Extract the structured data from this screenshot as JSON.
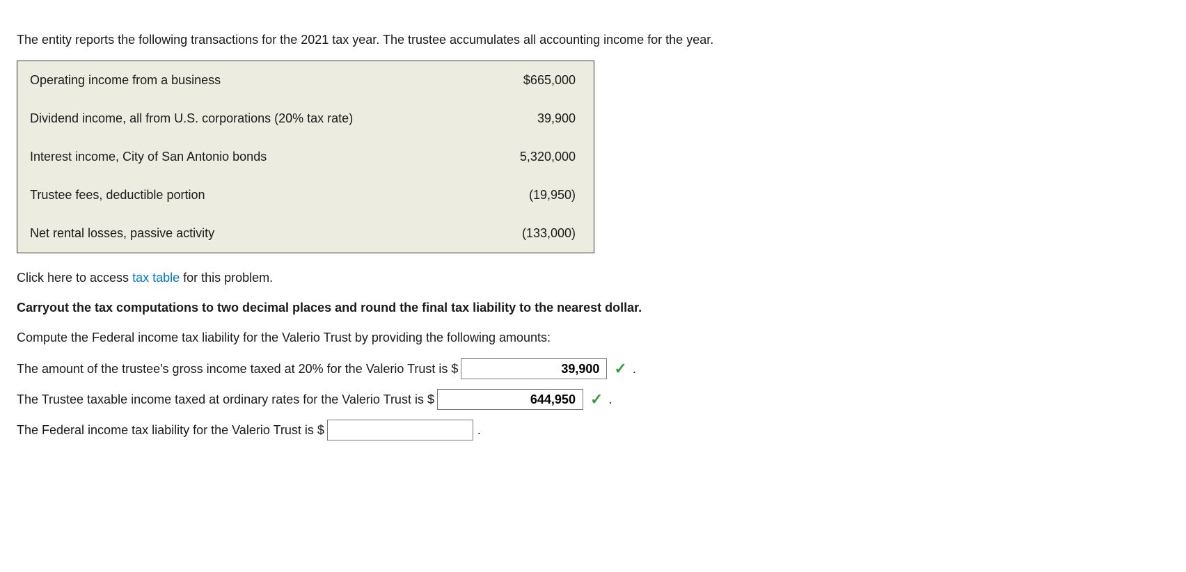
{
  "intro": "The entity reports the following transactions for the 2021 tax year. The trustee accumulates all accounting income for the year.",
  "table": {
    "rows": [
      {
        "label": "Operating income from a business",
        "amount": "$665,000"
      },
      {
        "label": "Dividend income, all from U.S. corporations (20% tax rate)",
        "amount": "39,900"
      },
      {
        "label": "Interest income, City of San Antonio bonds",
        "amount": "5,320,000"
      },
      {
        "label": "Trustee fees, deductible portion",
        "amount": "(19,950)"
      },
      {
        "label": "Net rental losses, passive activity",
        "amount": "(133,000)"
      }
    ]
  },
  "link_pre": "Click here to access ",
  "link_text": "tax table",
  "link_post": " for this problem.",
  "instruction": "Carryout the tax computations to two decimal places and round the final tax liability to the nearest dollar.",
  "compute_text": "Compute the Federal income tax liability for the Valerio Trust by providing the following amounts:",
  "answers": {
    "q1_text": "The amount of the trustee's gross income taxed at 20% for the Valerio Trust is $",
    "q1_value": "39,900",
    "q2_text": "The Trustee taxable income taxed at ordinary rates for the Valerio Trust is $",
    "q2_value": "644,950",
    "q3_text": "The Federal income tax liability for the Valerio Trust is $",
    "q3_value": ""
  },
  "period": "."
}
